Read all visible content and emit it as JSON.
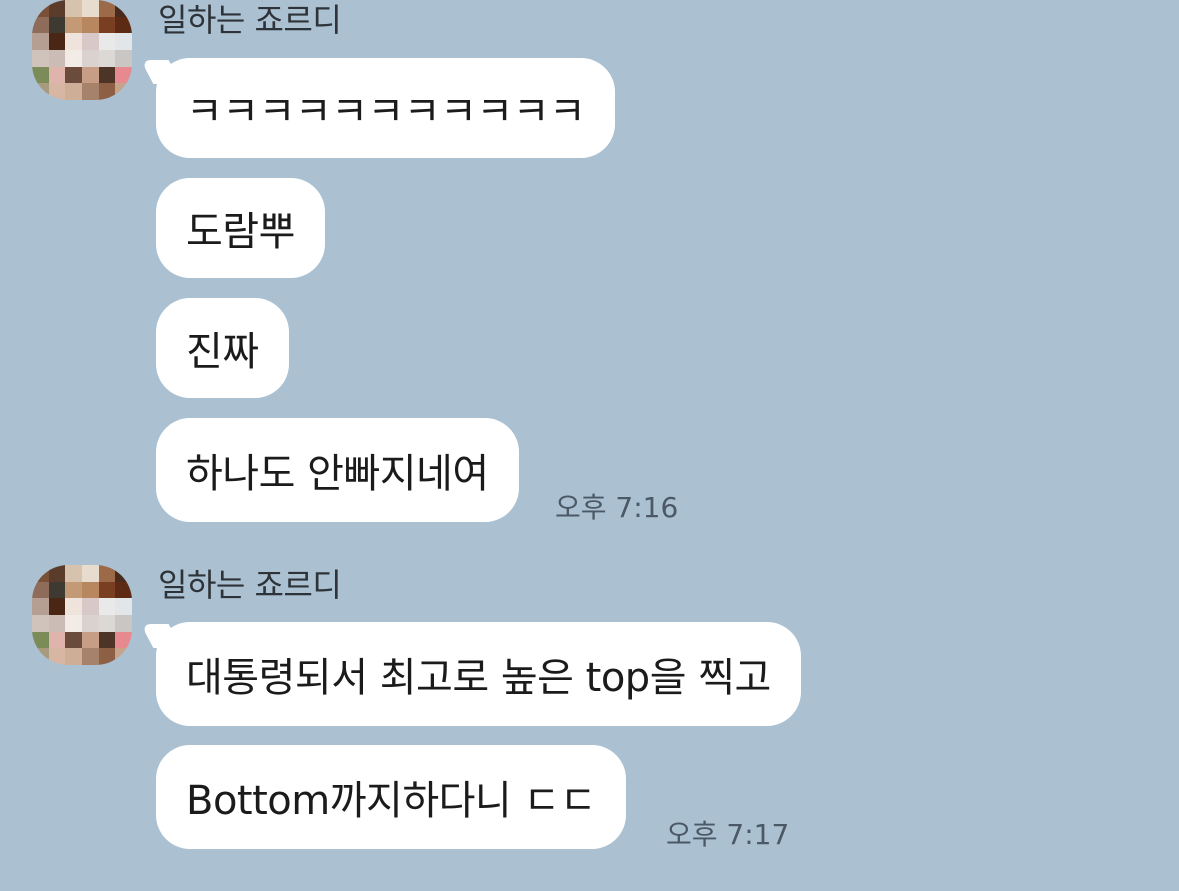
{
  "groups": [
    {
      "sender": "일하는 죠르디",
      "avatar_icon": "pixelated-profile-photo",
      "messages": [
        "ㅋㅋㅋㅋㅋㅋㅋㅋㅋㅋㅋ",
        "도람뿌",
        "진짜",
        "하나도 안빠지네여"
      ],
      "time": "오후 7:16"
    },
    {
      "sender": "일하는 죠르디",
      "avatar_icon": "pixelated-profile-photo",
      "messages": [
        "대통령되서 최고로 높은 top을 찍고",
        "Bottom까지하다니 ㄷㄷ"
      ],
      "time": "오후 7:17"
    }
  ],
  "colors": {
    "background": "#abc1d2",
    "bubble": "#ffffff",
    "time_text": "#4b5865"
  }
}
